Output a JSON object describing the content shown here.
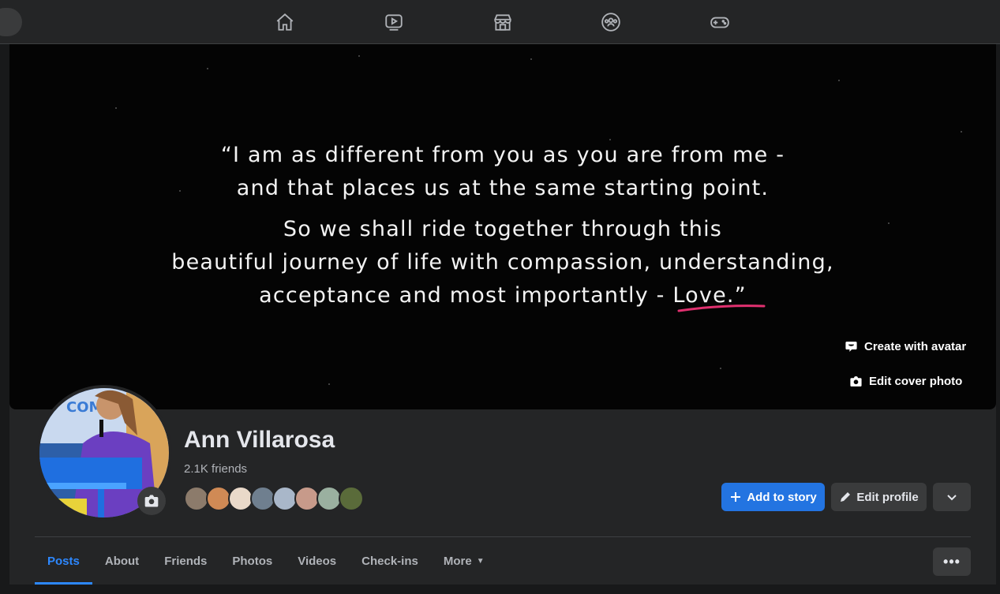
{
  "nav": {
    "icons": [
      "home-icon",
      "watch-icon",
      "marketplace-icon",
      "groups-icon",
      "gaming-icon"
    ]
  },
  "cover": {
    "quote_lines_a": [
      "“I am as different from you as you are from me -",
      "and that places us at the same starting point."
    ],
    "quote_lines_b": [
      "So we shall ride together through this",
      "beautiful journey of life with compassion, understanding,",
      "acceptance and most importantly - Love.”"
    ],
    "create_avatar_label": "Create with avatar",
    "edit_cover_label": "Edit cover photo"
  },
  "profile": {
    "name": "Ann Villarosa",
    "friend_count": "2.1K friends",
    "add_story_label": "Add to story",
    "edit_profile_label": "Edit profile"
  },
  "tabs": [
    {
      "label": "Posts",
      "active": true
    },
    {
      "label": "About"
    },
    {
      "label": "Friends"
    },
    {
      "label": "Photos"
    },
    {
      "label": "Videos"
    },
    {
      "label": "Check-ins"
    },
    {
      "label": "More",
      "caret": "▼"
    }
  ],
  "tabs_more_label": "•••",
  "colors": {
    "accent": "#2d88ff",
    "primary_button": "#2374e1",
    "surface": "#242526",
    "background": "#18191a"
  }
}
